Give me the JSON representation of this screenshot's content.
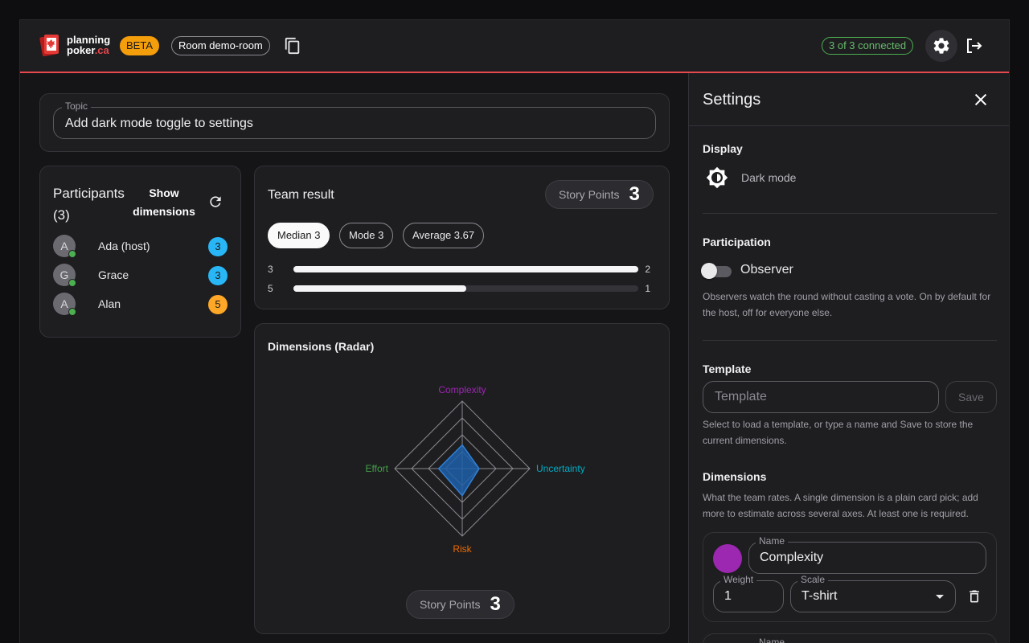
{
  "header": {
    "logo_line1": "planning",
    "logo_line2": "poker",
    "logo_suffix": ".ca",
    "beta": "BETA",
    "room": "Room demo-room",
    "connected": "3 of 3 connected",
    "accent": "#e5484d"
  },
  "topic": {
    "label": "Topic",
    "value": "Add dark mode toggle to settings"
  },
  "participants": {
    "title": "Participants (3)",
    "show_dimensions": "Show dimensions",
    "rows": [
      {
        "initial": "A",
        "name": "Ada (host)",
        "vote": "3",
        "vote_color": "#29b6f6"
      },
      {
        "initial": "G",
        "name": "Grace",
        "vote": "3",
        "vote_color": "#29b6f6"
      },
      {
        "initial": "A",
        "name": "Alan",
        "vote": "5",
        "vote_color": "#ffa726"
      }
    ]
  },
  "team_result": {
    "title": "Team result",
    "sp_label": "Story Points",
    "sp_value": "3",
    "stats": [
      "Median 3",
      "Mode 3",
      "Average 3.67"
    ],
    "distribution": [
      {
        "value": "3",
        "count": "2",
        "fraction": 1.0
      },
      {
        "value": "5",
        "count": "1",
        "fraction": 0.5
      }
    ]
  },
  "radar": {
    "title": "Dimensions (Radar)",
    "sp_label": "Story Points",
    "sp_value": "3",
    "axes": [
      {
        "label": "Complexity",
        "color": "#9c27b0",
        "value": 0.35
      },
      {
        "label": "Uncertainty",
        "color": "#00acc1",
        "value": 0.25
      },
      {
        "label": "Risk",
        "color": "#ef6c00",
        "value": 0.4
      },
      {
        "label": "Effort",
        "color": "#43a047",
        "value": 0.35
      }
    ]
  },
  "settings": {
    "title": "Settings",
    "display_title": "Display",
    "dark_mode": "Dark mode",
    "participation_title": "Participation",
    "observer": "Observer",
    "observer_on": false,
    "observer_help": "Observers watch the round without casting a vote. On by default for the host, off for everyone else.",
    "template_title": "Template",
    "template_placeholder": "Template",
    "save": "Save",
    "template_help": "Select to load a template, or type a name and Save to store the current dimensions.",
    "dimensions_title": "Dimensions",
    "dimensions_help": "What the team rates. A single dimension is a plain card pick; add more to estimate across several axes. At least one is required.",
    "dimension": {
      "color": "#9c27b0",
      "name_label": "Name",
      "name": "Complexity",
      "weight_label": "Weight",
      "weight": "1",
      "scale_label": "Scale",
      "scale": "T-shirt"
    },
    "dimension2": {
      "name_label": "Name"
    }
  }
}
